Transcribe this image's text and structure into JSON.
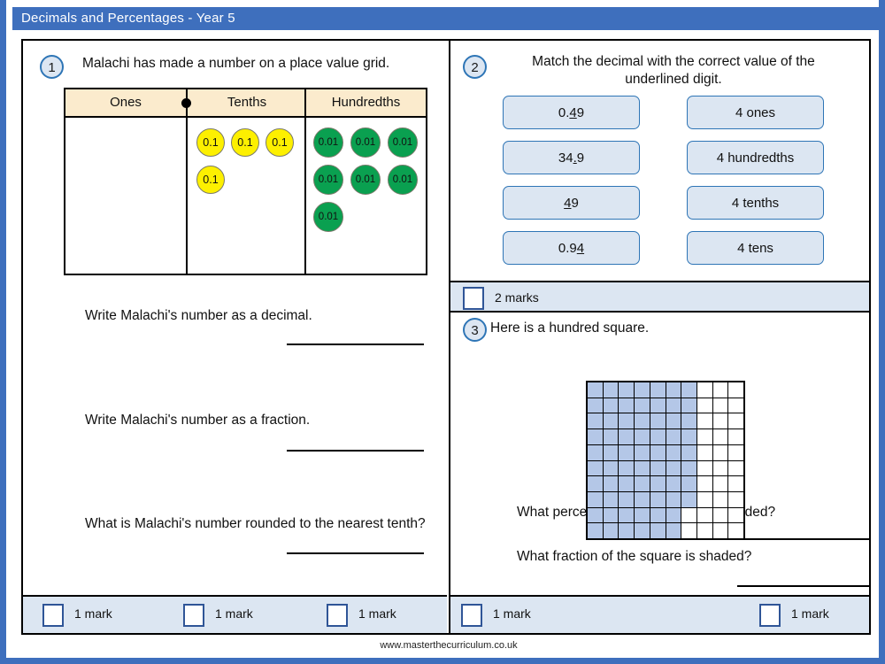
{
  "title": "Decimals and Percentages  - Year 5",
  "footer": "www.masterthecurriculum.co.uk",
  "colors": {
    "title_bar": "#3E6FBD",
    "grid_header": "#FBEBCD",
    "tenth_counter": "#FDF000",
    "hundredth_counter": "#0AA050",
    "option_fill": "#DCE6F2",
    "option_border": "#2E75B6",
    "shaded_cell": "#B4C7E7",
    "mark_box_border": "#2F5597"
  },
  "q1": {
    "number": "1",
    "prompt": "Malachi has made a number on a place value grid.",
    "grid": {
      "headers": [
        "Ones",
        "Tenths",
        "Hundredths"
      ],
      "decimal_point_icon": "decimal-point-dot",
      "ones_counters": [],
      "tenths_counters": [
        "0.1",
        "0.1",
        "0.1",
        "0.1"
      ],
      "hundredths_counters": [
        "0.01",
        "0.01",
        "0.01",
        "0.01",
        "0.01",
        "0.01",
        "0.01"
      ],
      "tenths_count": 4,
      "hundredths_count": 7
    },
    "parts": [
      "Write Malachi's number as a decimal.",
      "Write Malachi's number as a fraction.",
      "What is Malachi's number rounded to the nearest tenth?"
    ]
  },
  "q2": {
    "number": "2",
    "prompt": "Match the decimal with the correct value of the underlined  digit.",
    "left_options": [
      {
        "before": "0.",
        "underlined": "4",
        "after": "9"
      },
      {
        "before": "34",
        "underlined": ".",
        "after": "9"
      },
      {
        "before": "",
        "underlined": "4",
        "after": "9"
      },
      {
        "before": "0.9",
        "underlined": "4",
        "after": ""
      }
    ],
    "left_plain": [
      "0.49",
      "34.9",
      "49",
      "0.94"
    ],
    "right_options": [
      "4 ones",
      "4 hundredths",
      "4 tenths",
      "4 tens"
    ],
    "marks_label": "2 marks"
  },
  "q3": {
    "number": "3",
    "prompt": "Here is a hundred square.",
    "hundred_square": {
      "rows": 10,
      "cols": 10,
      "shaded_per_row": [
        7,
        7,
        7,
        7,
        7,
        7,
        7,
        7,
        6,
        6
      ],
      "total_shaded": 68
    },
    "parts": [
      "What percentage of the square is shaded?",
      "What fraction of the square is shaded?"
    ]
  },
  "marks": {
    "left_bar": [
      "1 mark",
      "1 mark",
      "1 mark"
    ],
    "right_bar": [
      "1 mark",
      "1 mark"
    ]
  }
}
